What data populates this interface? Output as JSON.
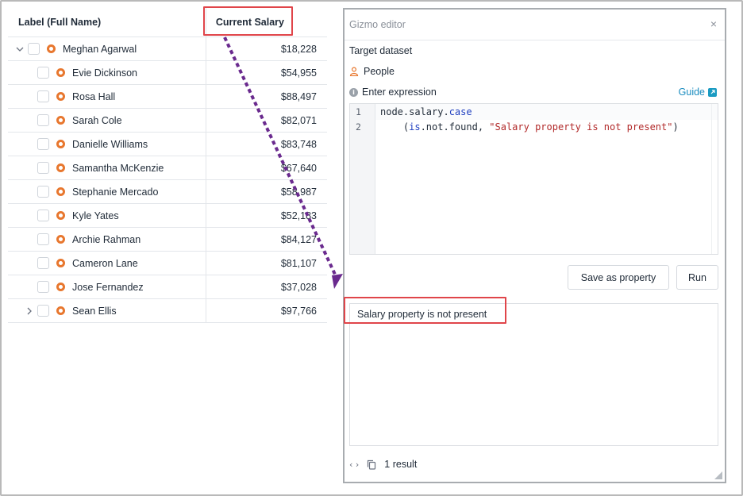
{
  "table": {
    "columns": {
      "label": "Label (Full Name)",
      "salary": "Current Salary"
    },
    "rows": [
      {
        "name": "Meghan Agarwal",
        "salary": "$18,228"
      },
      {
        "name": "Evie Dickinson",
        "salary": "$54,955"
      },
      {
        "name": "Rosa Hall",
        "salary": "$88,497"
      },
      {
        "name": "Sarah Cole",
        "salary": "$82,071"
      },
      {
        "name": "Danielle Williams",
        "salary": "$83,748"
      },
      {
        "name": "Samantha McKenzie",
        "salary": "$67,640"
      },
      {
        "name": "Stephanie Mercado",
        "salary": "$58,987"
      },
      {
        "name": "Kyle Yates",
        "salary": "$52,183"
      },
      {
        "name": "Archie Rahman",
        "salary": "$84,127"
      },
      {
        "name": "Cameron Lane",
        "salary": "$81,107"
      },
      {
        "name": "Jose Fernandez",
        "salary": "$37,028"
      },
      {
        "name": "Sean Ellis",
        "salary": "$97,766"
      }
    ]
  },
  "editor": {
    "title": "Gizmo editor",
    "close": "×",
    "target_label": "Target dataset",
    "dataset": "People",
    "expression_label": "Enter expression",
    "guide": "Guide",
    "code": {
      "line1_num": "1",
      "line2_num": "2",
      "line1_a": "node.salary.",
      "line1_kw": "case",
      "line2_indent": "    (",
      "line2_kw": "is",
      "line2_b": ".not.found, ",
      "line2_str": "\"Salary property is not present\"",
      "line2_end": ")"
    },
    "save_button": "Save as property",
    "run_button": "Run",
    "result_text": "Salary property is not present",
    "result_count": "1 result"
  },
  "colors": {
    "highlight": "#e0454a",
    "arrow": "#6a2a8e",
    "node_icon": "#e8772e",
    "link": "#1a8cbf"
  }
}
